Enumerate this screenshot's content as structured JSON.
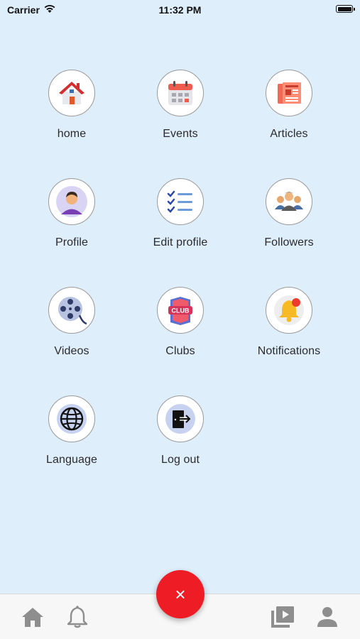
{
  "status_bar": {
    "carrier": "Carrier",
    "time": "11:32 PM"
  },
  "menu": {
    "items": [
      {
        "label": "home",
        "icon": "house-icon"
      },
      {
        "label": "Events",
        "icon": "calendar-icon"
      },
      {
        "label": "Articles",
        "icon": "newspaper-icon"
      },
      {
        "label": "Profile",
        "icon": "user-avatar-icon"
      },
      {
        "label": "Edit profile",
        "icon": "checklist-icon"
      },
      {
        "label": "Followers",
        "icon": "group-icon"
      },
      {
        "label": "Videos",
        "icon": "film-reel-icon"
      },
      {
        "label": "Clubs",
        "icon": "club-badge-icon"
      },
      {
        "label": "Notifications",
        "icon": "bell-icon"
      },
      {
        "label": "Language",
        "icon": "globe-icon"
      },
      {
        "label": "Log out",
        "icon": "exit-door-icon"
      }
    ]
  },
  "fab": {
    "symbol": "×",
    "color": "#ee1c25"
  },
  "tabbar": {
    "tabs": [
      "home-icon",
      "bell-icon",
      "video-library-icon",
      "person-icon"
    ]
  },
  "colors": {
    "background": "#dfeefb",
    "accent": "#ee1c25"
  }
}
